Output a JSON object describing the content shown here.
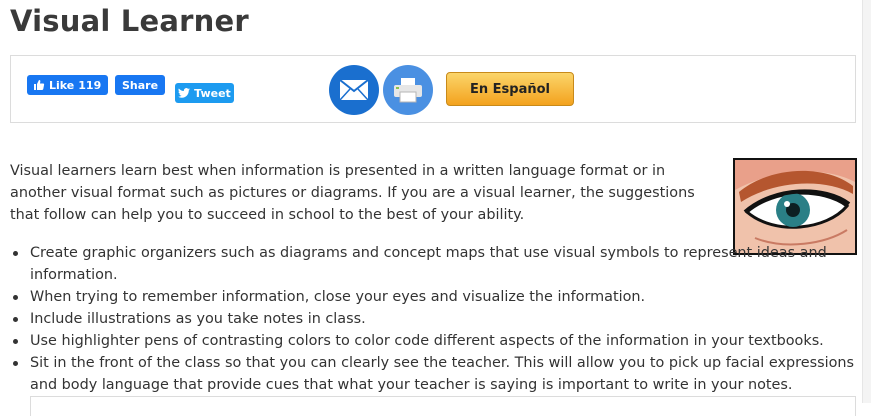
{
  "header": {
    "title": "Visual Learner"
  },
  "share": {
    "like_label": "Like",
    "like_count": "119",
    "share_label": "Share",
    "tweet_label": "Tweet",
    "espanol_label": "En Español",
    "icons": {
      "like": "thumbs-up-icon",
      "tweet": "twitter-bird-icon",
      "email": "envelope-icon",
      "print": "printer-icon"
    },
    "colors": {
      "facebook": "#1877f2",
      "twitter": "#1d9bf0",
      "email": "#1a6fcf",
      "print": "#4a90e2",
      "espanol": "#f3a21e"
    }
  },
  "main": {
    "intro": "Visual learners learn best when information is presented in a written language format or in another visual format such as pictures or diagrams. If you are a visual learner, the suggestions that follow can help you to succeed in school to the best of your ability.",
    "tips": [
      "Create graphic organizers such as diagrams and concept maps that use visual symbols to represent ideas and information.",
      "When trying to remember information, close your eyes and visualize the information.",
      "Include illustrations as you take notes in class.",
      "Use highlighter pens of contrasting colors to color code different aspects of the information in your textbooks.",
      "Sit in the front of the class so that you can clearly see the teacher. This will allow you to pick up facial expressions and body language that provide cues that what your teacher is saying is important to write in your notes."
    ]
  }
}
